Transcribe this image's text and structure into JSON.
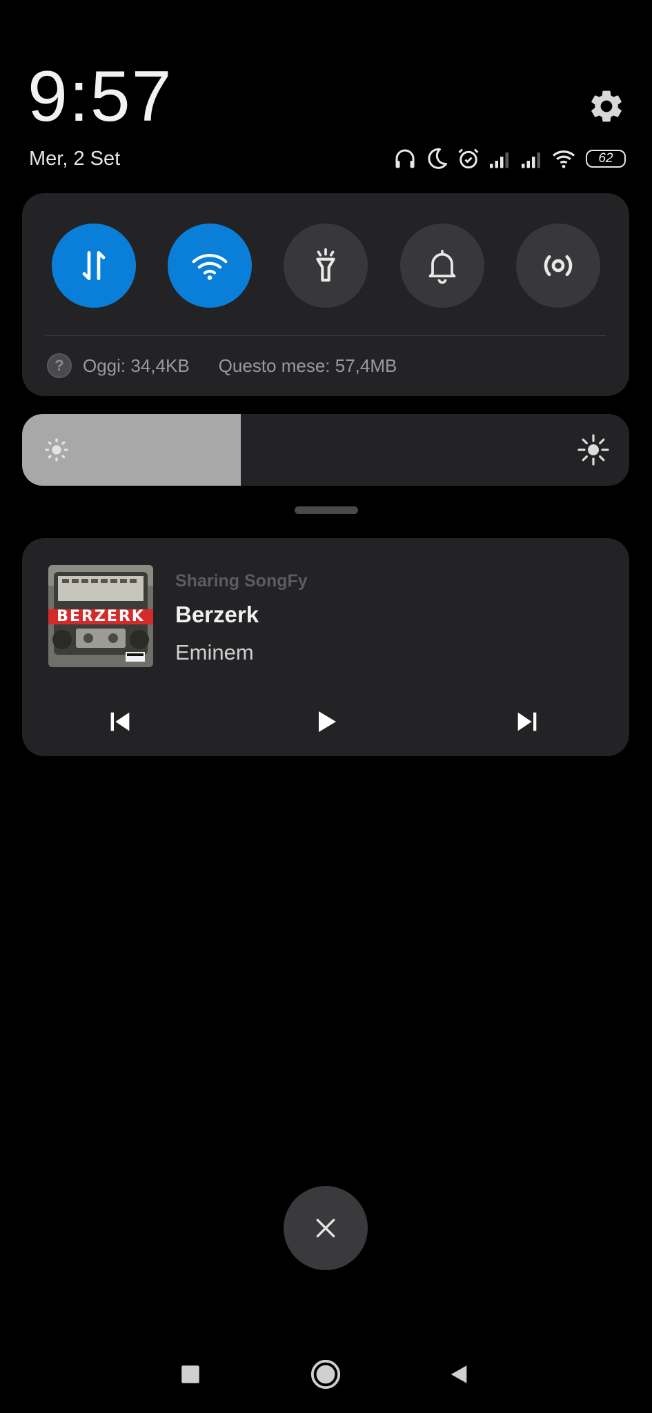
{
  "header": {
    "time": "9:57",
    "date": "Mer, 2 Set",
    "battery_level": "62",
    "status_icons": [
      "headphones-icon",
      "do-not-disturb-moon-icon",
      "alarm-clock-icon",
      "cellular-signal-icon",
      "cellular-signal-icon",
      "wifi-icon",
      "battery-icon"
    ],
    "settings_icon": "gear-icon"
  },
  "quick_settings": {
    "toggles": [
      {
        "name": "mobile-data",
        "icon": "data-transfer-arrows-icon",
        "active": true
      },
      {
        "name": "wifi",
        "icon": "wifi-icon",
        "active": true
      },
      {
        "name": "flashlight",
        "icon": "flashlight-icon",
        "active": false
      },
      {
        "name": "sound",
        "icon": "bell-icon",
        "active": false
      },
      {
        "name": "hotspot",
        "icon": "hotspot-icon",
        "active": false
      }
    ],
    "usage_today": "Oggi: 34,4KB",
    "usage_month": "Questo mese: 57,4MB"
  },
  "brightness": {
    "level": 0.36
  },
  "media": {
    "app": "Sharing SongFy",
    "title": "Berzerk",
    "artist": "Eminem",
    "album_art_text": "BERZERK",
    "controls": [
      "previous-icon",
      "play-icon",
      "next-icon"
    ]
  },
  "colors": {
    "background": "#000000",
    "panel": "#232325",
    "accent": "#0a7fd9",
    "inactive_toggle": "#38383a",
    "brightness_fill": "#a8a8a8"
  },
  "navigation": [
    "recents-square-icon",
    "home-circle-icon",
    "back-triangle-icon"
  ]
}
